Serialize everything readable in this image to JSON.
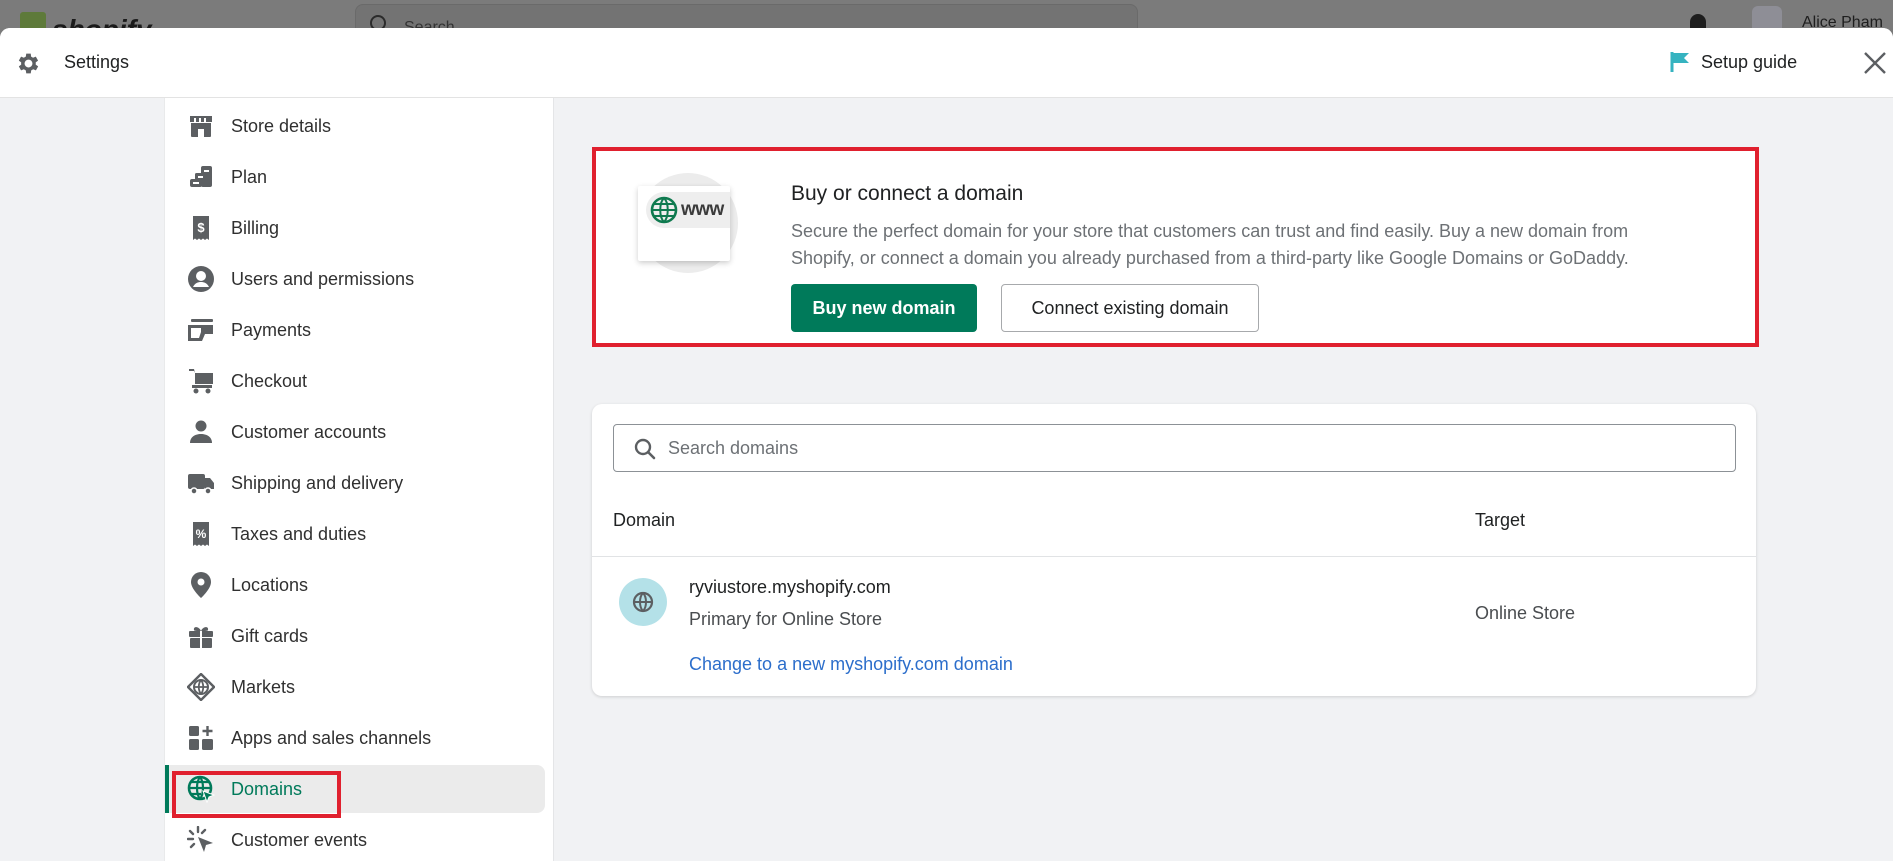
{
  "topbar": {
    "logo_text": "shopify",
    "search_placeholder": "Search",
    "user_name": "Alice Pham"
  },
  "header": {
    "title": "Settings",
    "setup_guide_label": "Setup guide",
    "accent_flag_color": "#36b3c0"
  },
  "sidebar": {
    "items": [
      {
        "label": "Store details",
        "icon": "store-icon"
      },
      {
        "label": "Plan",
        "icon": "plan-icon"
      },
      {
        "label": "Billing",
        "icon": "billing-receipt-icon"
      },
      {
        "label": "Users and permissions",
        "icon": "user-circle-icon"
      },
      {
        "label": "Payments",
        "icon": "payments-icon"
      },
      {
        "label": "Checkout",
        "icon": "cart-icon"
      },
      {
        "label": "Customer accounts",
        "icon": "person-icon"
      },
      {
        "label": "Shipping and delivery",
        "icon": "truck-icon"
      },
      {
        "label": "Taxes and duties",
        "icon": "tax-receipt-icon"
      },
      {
        "label": "Locations",
        "icon": "location-pin-icon"
      },
      {
        "label": "Gift cards",
        "icon": "gift-icon"
      },
      {
        "label": "Markets",
        "icon": "globe-markets-icon"
      },
      {
        "label": "Apps and sales channels",
        "icon": "apps-icon"
      },
      {
        "label": "Domains",
        "icon": "globe-cursor-icon",
        "active": true
      },
      {
        "label": "Customer events",
        "icon": "cursor-click-icon"
      }
    ],
    "active_color": "#007a5a"
  },
  "promo": {
    "title": "Buy or connect a domain",
    "description": "Secure the perfect domain for your store that customers can trust and find easily. Buy a new domain from Shopify, or connect a domain you already purchased from a third-party like Google Domains or GoDaddy.",
    "illustration_text": "www",
    "buy_button": "Buy new domain",
    "connect_button": "Connect existing domain",
    "primary_color": "#007a5a",
    "highlight_color": "#e0202e"
  },
  "domains": {
    "search_placeholder": "Search domains",
    "search_value": "",
    "columns": [
      "Domain",
      "Target"
    ],
    "rows": [
      {
        "domain": "ryviustore.myshopify.com",
        "subtitle": "Primary for Online Store",
        "link": "Change to a new myshopify.com domain",
        "target": "Online Store"
      }
    ]
  }
}
